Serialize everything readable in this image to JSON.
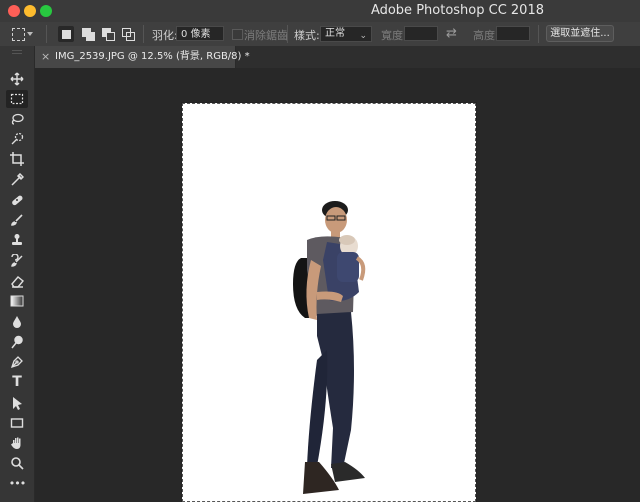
{
  "window": {
    "title": "Adobe Photoshop CC 2018",
    "controls": [
      "close",
      "minimize",
      "zoom"
    ]
  },
  "options_bar": {
    "tool_preset_icon": "rect-marquee-icon",
    "selection_modes": [
      "new-selection",
      "add-to-selection",
      "subtract-from-selection",
      "intersect-with-selection"
    ],
    "feather_label": "羽化:",
    "feather_value": "0 像素",
    "antialias_label": "消除鋸齒",
    "style_label": "樣式:",
    "style_value": "正常",
    "width_label": "寬度:",
    "height_label": "高度:",
    "mask_button_label": "選取並遮住..."
  },
  "document_tab": {
    "close": "×",
    "title": "IMG_2539.JPG @ 12.5% (背景, RGB/8) *"
  },
  "tools": [
    {
      "name": "move-tool"
    },
    {
      "name": "rectangular-marquee-tool",
      "active": true
    },
    {
      "name": "lasso-tool"
    },
    {
      "name": "quick-selection-tool"
    },
    {
      "name": "crop-tool"
    },
    {
      "name": "eyedropper-tool"
    },
    {
      "name": "healing-brush-tool"
    },
    {
      "name": "brush-tool"
    },
    {
      "name": "clone-stamp-tool"
    },
    {
      "name": "history-brush-tool"
    },
    {
      "name": "eraser-tool"
    },
    {
      "name": "gradient-tool"
    },
    {
      "name": "blur-tool"
    },
    {
      "name": "dodge-tool"
    },
    {
      "name": "pen-tool"
    },
    {
      "name": "type-tool",
      "glyph": "T"
    },
    {
      "name": "path-selection-tool"
    },
    {
      "name": "rectangle-tool"
    },
    {
      "name": "hand-tool"
    },
    {
      "name": "zoom-tool"
    },
    {
      "name": "edit-toolbar",
      "glyph": "•••"
    }
  ],
  "colors": {
    "accent_close": "#fe5f57",
    "accent_min": "#febc2e",
    "accent_zoom": "#28c840",
    "canvas_bg": "#282828",
    "document_bg": "#ffffff"
  }
}
